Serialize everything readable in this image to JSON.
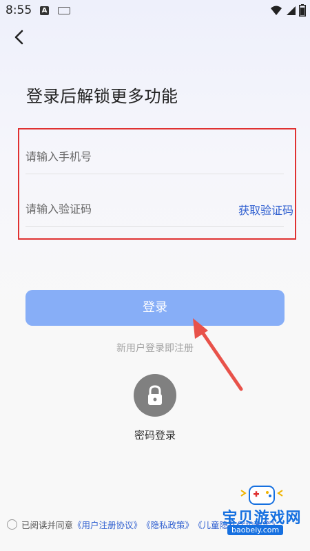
{
  "status_bar": {
    "time": "8:55",
    "notif_letter": "A"
  },
  "header": {
    "headline": "登录后解锁更多功能"
  },
  "form": {
    "phone_placeholder": "请输入手机号",
    "code_placeholder": "请输入验证码",
    "get_code_label": "获取验证码"
  },
  "login": {
    "button_label": "登录",
    "subtext": "新用户登录即注册"
  },
  "password_login": {
    "label": "密码登录"
  },
  "agreement": {
    "prefix": "已阅读并同意",
    "user_agreement": "《用户注册协议》",
    "privacy_policy": "《隐私政策》",
    "child_policy": "《儿童隐私保护政策》"
  },
  "watermark": {
    "title": "宝贝游戏网",
    "url": "baobeiy.com"
  },
  "colors": {
    "accent": "#2f5fd0",
    "button": "#87aef7",
    "highlight_box": "#e03131",
    "arrow": "#e8524a"
  }
}
